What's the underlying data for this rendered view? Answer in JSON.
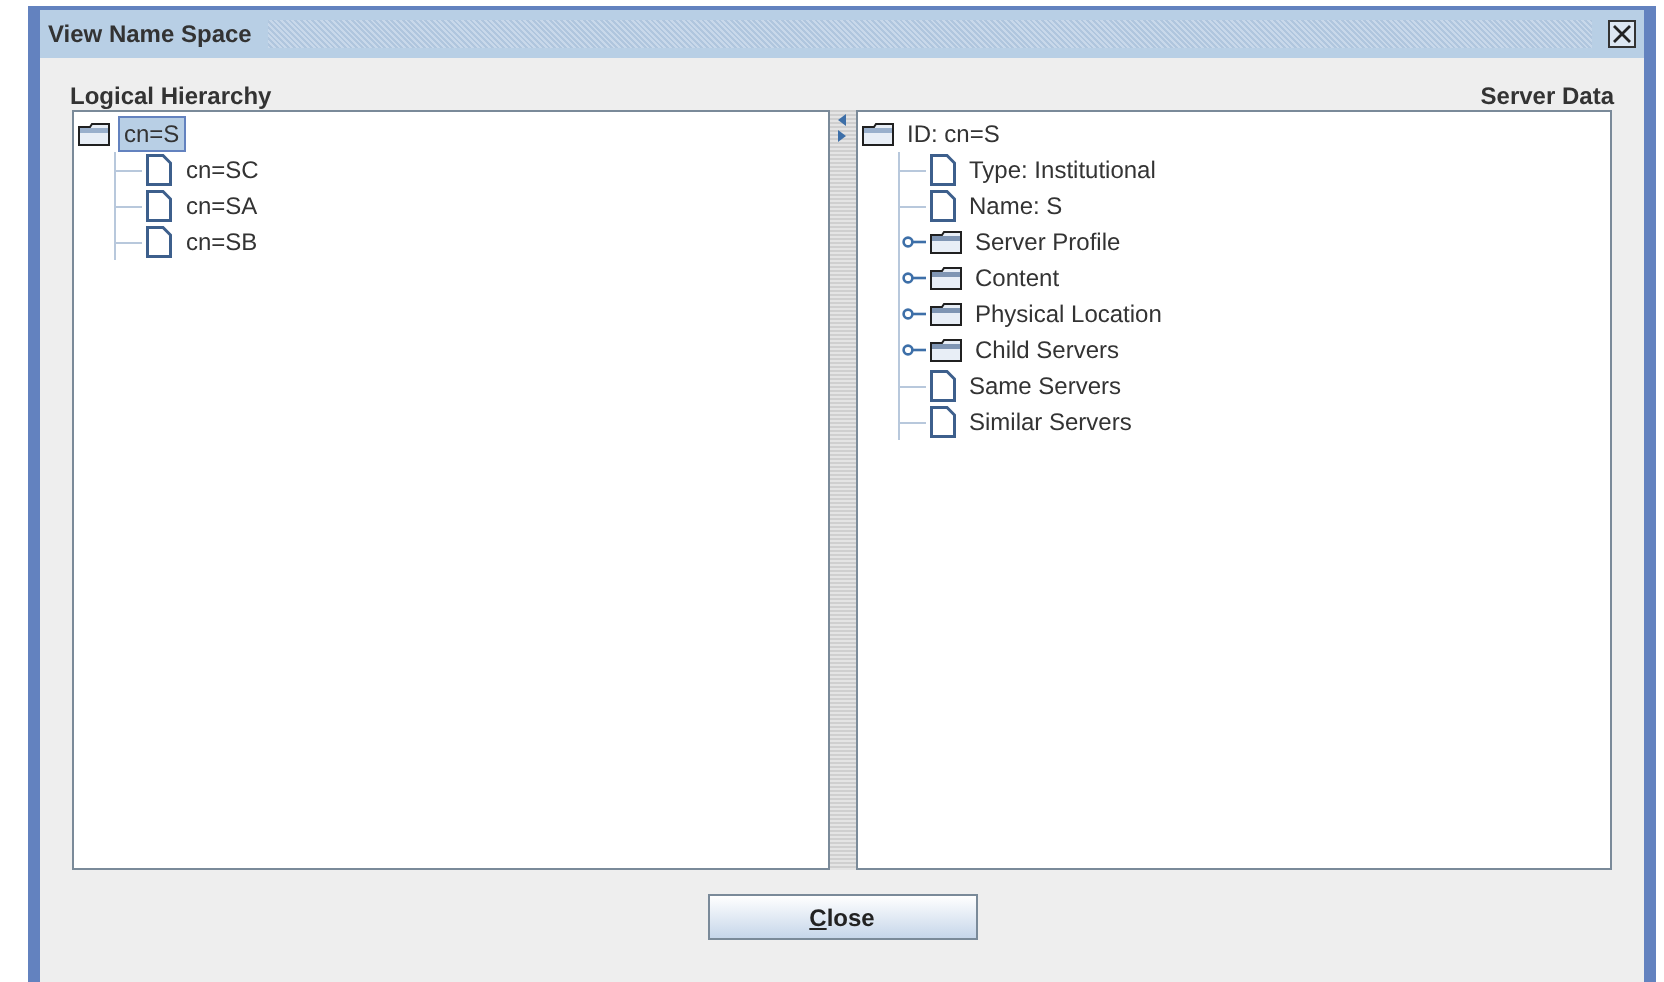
{
  "window": {
    "title": "View Name Space"
  },
  "left_panel": {
    "heading": "Logical Hierarchy",
    "tree": [
      {
        "label": "cn=S",
        "kind": "folder",
        "expanded": true,
        "selected": true,
        "children": [
          {
            "label": "cn=SC",
            "kind": "leaf",
            "selected": false
          },
          {
            "label": "cn=SA",
            "kind": "leaf",
            "selected": false
          },
          {
            "label": "cn=SB",
            "kind": "leaf",
            "selected": false
          }
        ]
      }
    ]
  },
  "right_panel": {
    "heading": "Server Data",
    "tree": [
      {
        "label": "ID: cn=S",
        "kind": "folder",
        "expanded": true,
        "selected": false,
        "children": [
          {
            "label": "Type: Institutional",
            "kind": "leaf",
            "selected": false
          },
          {
            "label": "Name: S",
            "kind": "leaf",
            "selected": false
          },
          {
            "label": "Server Profile",
            "kind": "folder",
            "expanded": false,
            "selected": false
          },
          {
            "label": "Content",
            "kind": "folder",
            "expanded": false,
            "selected": false
          },
          {
            "label": "Physical Location",
            "kind": "folder",
            "expanded": false,
            "selected": false
          },
          {
            "label": "Child Servers",
            "kind": "folder",
            "expanded": false,
            "selected": false
          },
          {
            "label": "Same Servers",
            "kind": "leaf",
            "selected": false
          },
          {
            "label": "Similar Servers",
            "kind": "leaf",
            "selected": false
          }
        ]
      }
    ]
  },
  "buttons": [
    {
      "label": "Close"
    }
  ]
}
